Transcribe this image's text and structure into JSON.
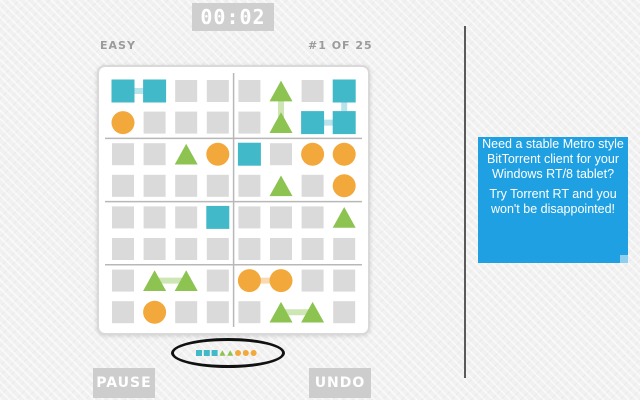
{
  "timer": "00:02",
  "difficulty": "EASY",
  "puzzle_progress": "#1 OF 25",
  "buttons": {
    "pause": "PAUSE",
    "undo": "UNDO"
  },
  "colors": {
    "square": "#41b9c9",
    "triangle": "#8dc351",
    "circle": "#f3a83b",
    "empty": "#dadada"
  },
  "grid": {
    "size": 8,
    "cells": [
      [
        "square",
        "square",
        "empty",
        "empty",
        "empty",
        "triangle",
        "empty",
        "square"
      ],
      [
        "circle",
        "empty",
        "empty",
        "empty",
        "empty",
        "triangle",
        "square",
        "square"
      ],
      [
        "empty",
        "empty",
        "triangle",
        "circle",
        "square",
        "empty",
        "circle",
        "circle"
      ],
      [
        "empty",
        "empty",
        "empty",
        "empty",
        "empty",
        "triangle",
        "empty",
        "circle"
      ],
      [
        "empty",
        "empty",
        "empty",
        "square",
        "empty",
        "empty",
        "empty",
        "triangle"
      ],
      [
        "empty",
        "empty",
        "empty",
        "empty",
        "empty",
        "empty",
        "empty",
        "empty"
      ],
      [
        "empty",
        "triangle",
        "triangle",
        "empty",
        "circle",
        "circle",
        "empty",
        "empty"
      ],
      [
        "empty",
        "circle",
        "empty",
        "empty",
        "empty",
        "triangle",
        "triangle",
        "empty"
      ]
    ],
    "links": [
      {
        "row": 0,
        "col": 0,
        "dir": "right"
      },
      {
        "row": 0,
        "col": 5,
        "dir": "down"
      },
      {
        "row": 0,
        "col": 7,
        "dir": "down"
      },
      {
        "row": 1,
        "col": 6,
        "dir": "right"
      },
      {
        "row": 6,
        "col": 1,
        "dir": "right"
      },
      {
        "row": 6,
        "col": 4,
        "dir": "right"
      },
      {
        "row": 7,
        "col": 5,
        "dir": "right"
      }
    ]
  },
  "tray_pieces": [
    "square",
    "square",
    "square",
    "triangle",
    "triangle",
    "circle",
    "circle",
    "circle"
  ],
  "ad": {
    "question": "Need a stable Metro style BitTorrent client for your Windows RT/8 tablet?",
    "pitch": "Try Torrent RT and you won't be disappointed!"
  }
}
